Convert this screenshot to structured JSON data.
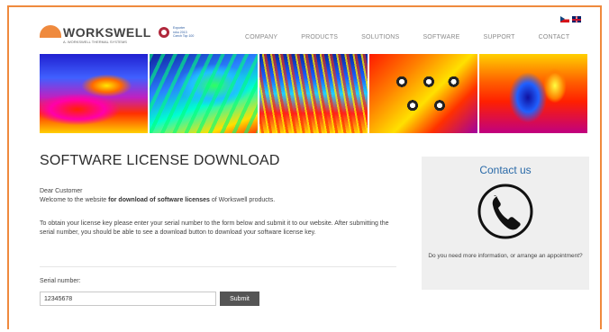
{
  "header": {
    "logo_text": "WORKSWELL",
    "logo_sub": "A. WORKSWELL THERMAL SYSTEMS",
    "partner_text": "Exporter\nroku 2013\nCzech Top 100",
    "nav": [
      "COMPANY",
      "PRODUCTS",
      "SOLUTIONS",
      "SOFTWARE",
      "SUPPORT",
      "CONTACT"
    ],
    "languages": [
      "cz",
      "en"
    ]
  },
  "main": {
    "title": "SOFTWARE LICENSE DOWNLOAD",
    "greeting": "Dear Customer",
    "welcome_pre": "Welcome to the website ",
    "welcome_bold": "for download of software licenses",
    "welcome_post": " of Workswell products.",
    "instructions": "To obtain your license key please enter your serial number to the form below and submit it to our website. After submitting the serial number, you should be able to see a download button to download your software license key.",
    "serial_label": "Serial number:",
    "serial_value": "12345678",
    "submit_label": "Submit"
  },
  "contact": {
    "title": "Contact us",
    "icon": "phone-icon",
    "text": "Do you need more information, or arrange an appointment?"
  },
  "colors": {
    "accent_border": "#ef8a3e",
    "link_blue": "#2a6aa8",
    "button": "#555555"
  }
}
